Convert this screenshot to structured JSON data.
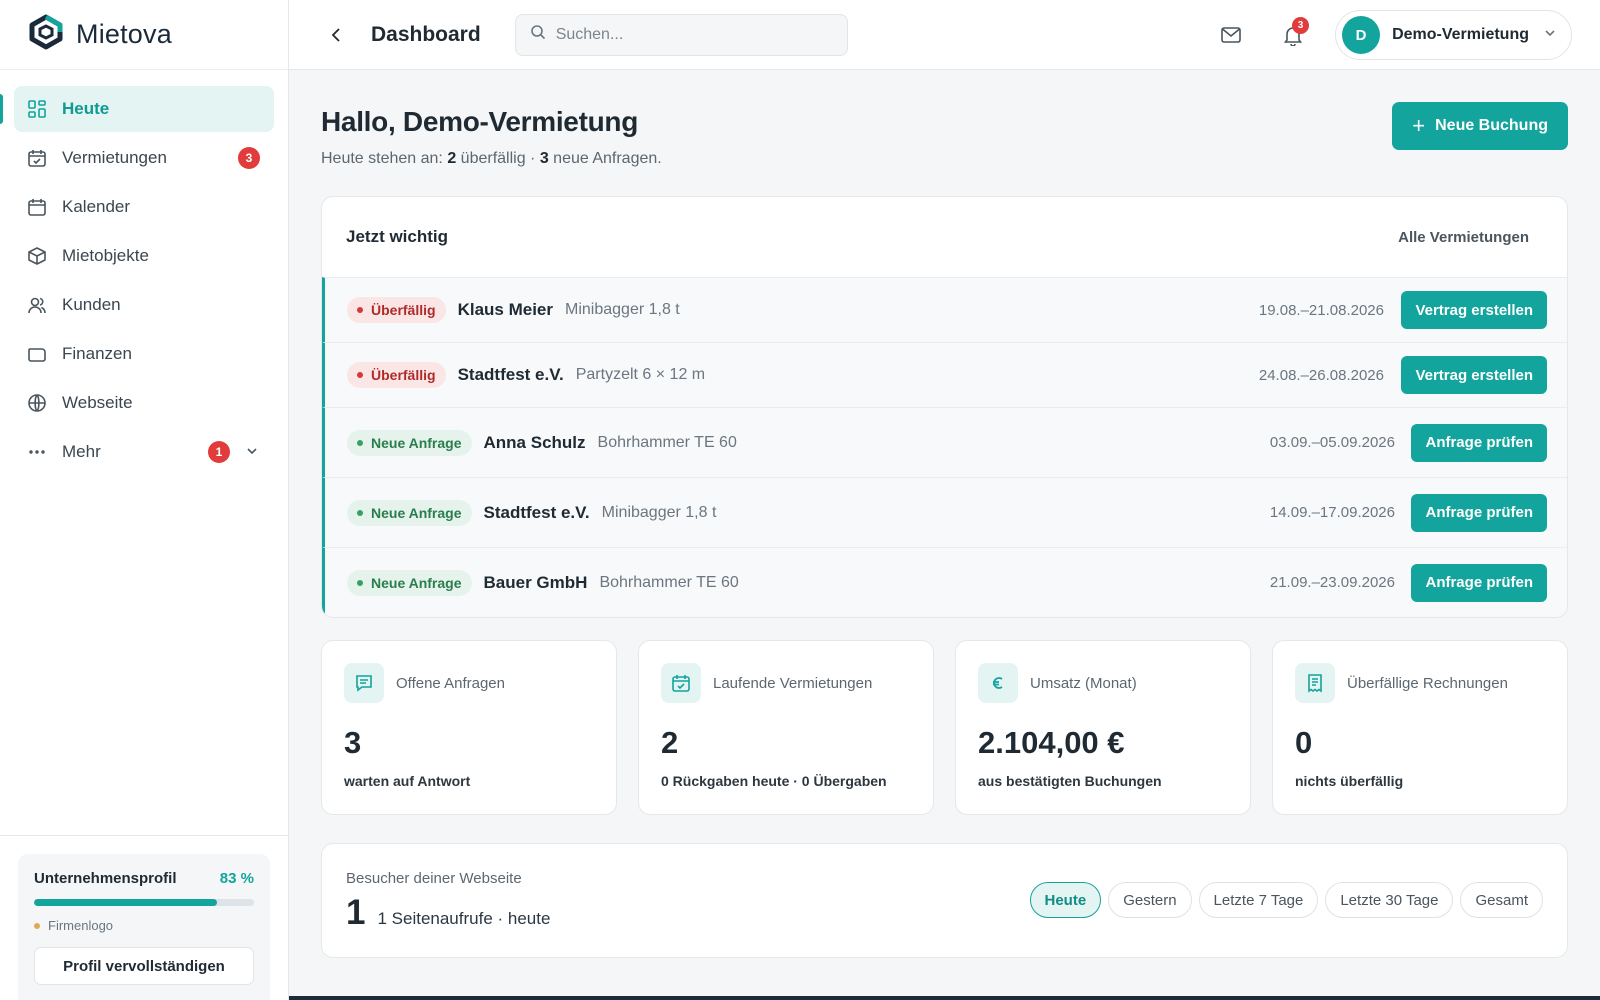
{
  "brand": {
    "name": "Mietova"
  },
  "sidebar": {
    "items": [
      {
        "label": "Heute",
        "icon": "grid-icon",
        "active": true
      },
      {
        "label": "Vermietungen",
        "icon": "calendar-check-icon",
        "badge": "3"
      },
      {
        "label": "Kalender",
        "icon": "calendar-icon"
      },
      {
        "label": "Mietobjekte",
        "icon": "box-icon"
      },
      {
        "label": "Kunden",
        "icon": "users-icon"
      },
      {
        "label": "Finanzen",
        "icon": "wallet-icon"
      },
      {
        "label": "Webseite",
        "icon": "globe-icon"
      },
      {
        "label": "Mehr",
        "icon": "more-icon",
        "badge": "1"
      }
    ],
    "profile": {
      "title": "Unternehmensprofil",
      "percent_label": "83 %",
      "percent": 83,
      "hint": "Firmenlogo",
      "button": "Profil vervollständigen"
    }
  },
  "topbar": {
    "title": "Dashboard",
    "search_placeholder": "Suchen...",
    "notification_count": "3",
    "account_initial": "D",
    "account_name": "Demo-Vermietung"
  },
  "main": {
    "greeting": "Hallo, Demo-Vermietung",
    "subline_prefix": "Heute stehen an: ",
    "subline_overdue_count": "2",
    "subline_overdue_text": " überfällig · ",
    "subline_new_count": "3",
    "subline_new_text": " neue Anfragen.",
    "new_booking_button": "Neue Buchung"
  },
  "important": {
    "title": "Jetzt wichtig",
    "link": "Alle Vermietungen",
    "rows": [
      {
        "status": "Überfällig",
        "type": "overdue",
        "name": "Klaus Meier",
        "item": "Minibagger 1,8 t",
        "date": "19.08.–21.08.2026",
        "action": "Vertrag erstellen"
      },
      {
        "status": "Überfällig",
        "type": "overdue",
        "name": "Stadtfest e.V.",
        "item": "Partyzelt 6 × 12 m",
        "date": "24.08.–26.08.2026",
        "action": "Vertrag erstellen"
      },
      {
        "status": "Neue Anfrage",
        "type": "new",
        "name": "Anna Schulz",
        "item": "Bohrhammer TE 60",
        "date": "03.09.–05.09.2026",
        "action": "Anfrage prüfen"
      },
      {
        "status": "Neue Anfrage",
        "type": "new",
        "name": "Stadtfest e.V.",
        "item": "Minibagger 1,8 t",
        "date": "14.09.–17.09.2026",
        "action": "Anfrage prüfen"
      },
      {
        "status": "Neue Anfrage",
        "type": "new",
        "name": "Bauer GmbH",
        "item": "Bohrhammer TE 60",
        "date": "21.09.–23.09.2026",
        "action": "Anfrage prüfen"
      }
    ]
  },
  "stats": [
    {
      "label": "Offene Anfragen",
      "icon": "message-icon",
      "value": "3",
      "sub": "warten auf Antwort"
    },
    {
      "label": "Laufende Vermietungen",
      "icon": "calendar-check-icon",
      "value": "2",
      "sub": "0 Rückgaben heute · 0 Übergaben"
    },
    {
      "label": "Umsatz (Monat)",
      "icon": "euro-icon",
      "value": "2.104,00 €",
      "sub": "aus bestätigten Buchungen"
    },
    {
      "label": "Überfällige Rechnungen",
      "icon": "receipt-icon",
      "value": "0",
      "sub": "nichts überfällig"
    }
  ],
  "visitors": {
    "label": "Besucher deiner Webseite",
    "count": "1",
    "text": "1 Seitenaufrufe · heute",
    "ranges": [
      "Heute",
      "Gestern",
      "Letzte 7 Tage",
      "Letzte 30 Tage",
      "Gesamt"
    ],
    "active_range": "Heute"
  },
  "colors": {
    "accent": "#12a49d",
    "danger": "#e23b3b",
    "success": "#37a064"
  }
}
